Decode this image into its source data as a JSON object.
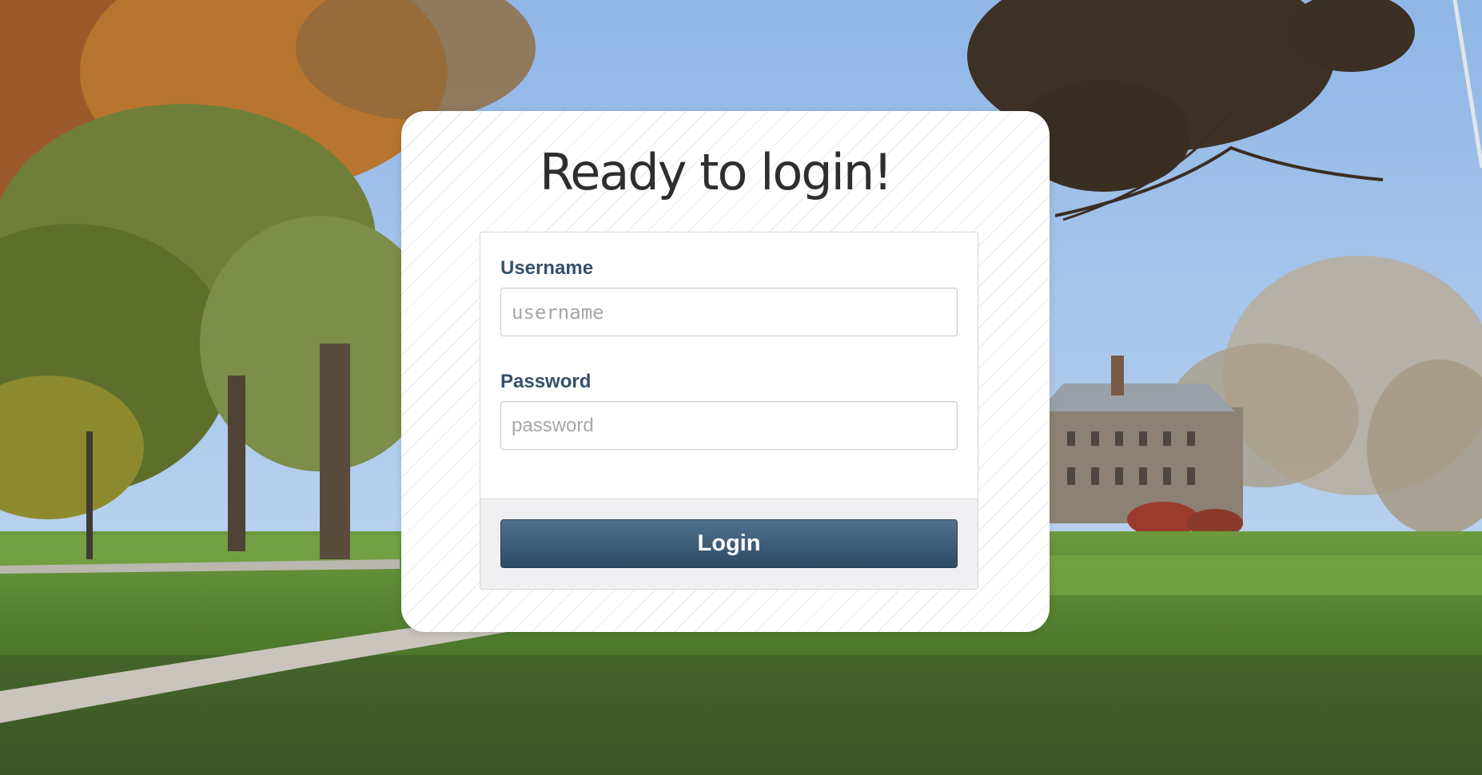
{
  "page": {
    "title": "Ready to login!"
  },
  "form": {
    "username_label": "Username",
    "username_placeholder": "username",
    "username_value": "",
    "password_label": "Password",
    "password_placeholder": "password",
    "password_value": "",
    "login_label": "Login"
  },
  "colors": {
    "label": "#35506a",
    "button_top": "#51718e",
    "button_bottom": "#2f4a63",
    "card": "#ffffff",
    "footer": "#f0f0f2"
  }
}
